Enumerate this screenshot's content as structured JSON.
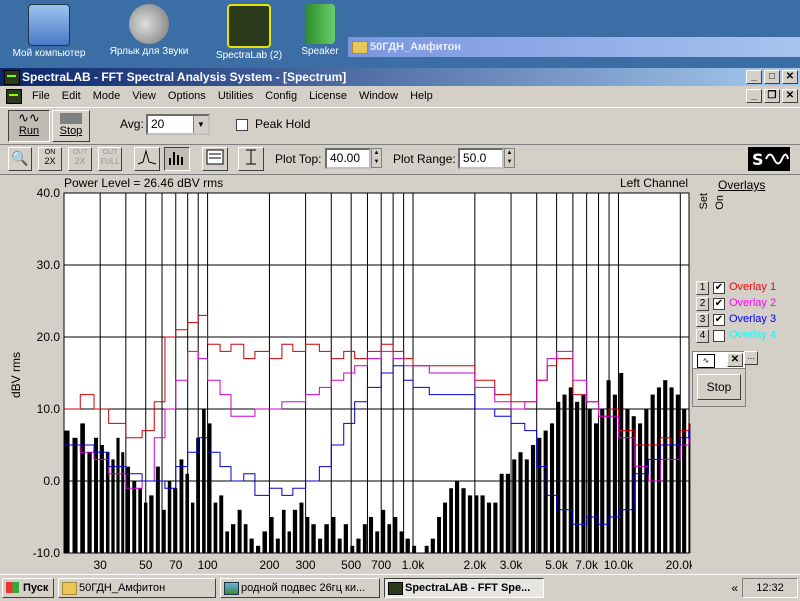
{
  "desktop": {
    "icons": [
      {
        "label": "Мой компьютер",
        "icon": "computer-icon"
      },
      {
        "label": "Ярлык для Звуки",
        "icon": "speaker-icon"
      },
      {
        "label": "SpectraLab (2)",
        "icon": "spectralab-icon"
      },
      {
        "label": "Speaker",
        "icon": "speaker-shortcut-icon"
      }
    ],
    "bg_window_title": "50ГДН_Амфитон"
  },
  "window": {
    "title": "SpectraLAB - FFT Spectral Analysis System - [Spectrum]"
  },
  "menu": [
    "File",
    "Edit",
    "Mode",
    "View",
    "Options",
    "Utilities",
    "Config",
    "License",
    "Window",
    "Help"
  ],
  "toolbar": {
    "run_label": "Run",
    "stop_label": "Stop",
    "avg_label": "Avg:",
    "avg_value": "20",
    "peak_hold_label": "Peak Hold",
    "zoom_btns": [
      {
        "top": "ON",
        "bottom": "2X"
      },
      {
        "top": "OUT",
        "bottom": "2X"
      },
      {
        "top": "OUT",
        "bottom": "FULL"
      }
    ],
    "plot_top_label": "Plot Top:",
    "plot_top_value": "40.00",
    "plot_range_label": "Plot Range:",
    "plot_range_value": "50.0"
  },
  "chart_header": {
    "power_level": "Power Level = 26.46 dBV rms",
    "channel": "Left Channel"
  },
  "chart_data": {
    "type": "bar",
    "ylabel": "dBV rms",
    "ylim": [
      -10,
      40
    ],
    "xscale": "log",
    "xlim": [
      20,
      22050
    ],
    "yticks": [
      "40.0",
      "30.0",
      "20.0",
      "10.0",
      "0.0",
      "-10.0"
    ],
    "xticks": [
      {
        "f": 30,
        "label": "30"
      },
      {
        "f": 50,
        "label": "50"
      },
      {
        "f": 70,
        "label": "70"
      },
      {
        "f": 100,
        "label": "100"
      },
      {
        "f": 200,
        "label": "200"
      },
      {
        "f": 300,
        "label": "300"
      },
      {
        "f": 500,
        "label": "500"
      },
      {
        "f": 700,
        "label": "700"
      },
      {
        "f": 1000,
        "label": "1.0k"
      },
      {
        "f": 2000,
        "label": "2.0k"
      },
      {
        "f": 3000,
        "label": "3.0k"
      },
      {
        "f": 5000,
        "label": "5.0k"
      },
      {
        "f": 7000,
        "label": "7.0k"
      },
      {
        "f": 10000,
        "label": "10.0k"
      },
      {
        "f": 20000,
        "label": "20.0k"
      }
    ],
    "gridlines": [
      30,
      40,
      50,
      60,
      70,
      80,
      90,
      100,
      200,
      300,
      400,
      500,
      600,
      700,
      800,
      900,
      1000,
      2000,
      3000,
      4000,
      5000,
      6000,
      7000,
      8000,
      9000,
      10000,
      20000
    ],
    "spectrum": [
      [
        20,
        7
      ],
      [
        22,
        6
      ],
      [
        24,
        8
      ],
      [
        26,
        4
      ],
      [
        28,
        6
      ],
      [
        30,
        5
      ],
      [
        32,
        4
      ],
      [
        34,
        3
      ],
      [
        36,
        6
      ],
      [
        38,
        4
      ],
      [
        40,
        2
      ],
      [
        43,
        0
      ],
      [
        46,
        -1
      ],
      [
        49,
        -3
      ],
      [
        52,
        -2
      ],
      [
        56,
        2
      ],
      [
        60,
        -4
      ],
      [
        64,
        0
      ],
      [
        68,
        -1
      ],
      [
        73,
        3
      ],
      [
        78,
        1
      ],
      [
        83,
        -3
      ],
      [
        88,
        6
      ],
      [
        94,
        10
      ],
      [
        100,
        8
      ],
      [
        107,
        -3
      ],
      [
        114,
        -2
      ],
      [
        122,
        -7
      ],
      [
        130,
        -6
      ],
      [
        140,
        -4
      ],
      [
        150,
        -6
      ],
      [
        160,
        -8
      ],
      [
        172,
        -9
      ],
      [
        185,
        -7
      ],
      [
        200,
        -5
      ],
      [
        215,
        -8
      ],
      [
        230,
        -4
      ],
      [
        245,
        -7
      ],
      [
        260,
        -4
      ],
      [
        280,
        -3
      ],
      [
        300,
        -5
      ],
      [
        320,
        -6
      ],
      [
        345,
        -8
      ],
      [
        370,
        -6
      ],
      [
        400,
        -5
      ],
      [
        430,
        -8
      ],
      [
        460,
        -6
      ],
      [
        495,
        -9
      ],
      [
        530,
        -8
      ],
      [
        570,
        -6
      ],
      [
        610,
        -5
      ],
      [
        655,
        -7
      ],
      [
        700,
        -4
      ],
      [
        750,
        -6
      ],
      [
        800,
        -5
      ],
      [
        860,
        -7
      ],
      [
        920,
        -8
      ],
      [
        990,
        -9
      ],
      [
        1060,
        -10
      ],
      [
        1140,
        -9
      ],
      [
        1220,
        -8
      ],
      [
        1310,
        -5
      ],
      [
        1400,
        -3
      ],
      [
        1500,
        -1
      ],
      [
        1600,
        0
      ],
      [
        1720,
        -1
      ],
      [
        1850,
        -2
      ],
      [
        1990,
        -2
      ],
      [
        2130,
        -2
      ],
      [
        2290,
        -3
      ],
      [
        2460,
        -3
      ],
      [
        2640,
        1
      ],
      [
        2830,
        1
      ],
      [
        3040,
        3
      ],
      [
        3260,
        4
      ],
      [
        3500,
        3
      ],
      [
        3750,
        5
      ],
      [
        4030,
        6
      ],
      [
        4320,
        7
      ],
      [
        4640,
        8
      ],
      [
        4980,
        11
      ],
      [
        5340,
        12
      ],
      [
        5730,
        13
      ],
      [
        6150,
        11
      ],
      [
        6600,
        12
      ],
      [
        7080,
        10
      ],
      [
        7600,
        8
      ],
      [
        8150,
        10
      ],
      [
        8750,
        14
      ],
      [
        9390,
        12
      ],
      [
        10080,
        15
      ],
      [
        10810,
        10
      ],
      [
        11600,
        9
      ],
      [
        12450,
        8
      ],
      [
        13360,
        10
      ],
      [
        14340,
        12
      ],
      [
        15390,
        13
      ],
      [
        16510,
        14
      ],
      [
        17720,
        13
      ],
      [
        19020,
        12
      ],
      [
        20410,
        10
      ],
      [
        21900,
        8
      ]
    ],
    "series": [
      {
        "name": "Overlay 1",
        "color": "#cc0000",
        "values": [
          [
            20,
            10
          ],
          [
            24,
            12
          ],
          [
            28,
            10
          ],
          [
            33,
            8
          ],
          [
            40,
            6
          ],
          [
            48,
            7
          ],
          [
            55,
            11
          ],
          [
            62,
            20
          ],
          [
            70,
            21
          ],
          [
            80,
            22
          ],
          [
            90,
            23
          ],
          [
            100,
            19
          ],
          [
            115,
            18
          ],
          [
            130,
            19
          ],
          [
            150,
            17
          ],
          [
            170,
            18
          ],
          [
            200,
            17
          ],
          [
            230,
            19
          ],
          [
            260,
            18
          ],
          [
            300,
            19
          ],
          [
            350,
            18
          ],
          [
            400,
            17
          ],
          [
            460,
            18
          ],
          [
            520,
            17
          ],
          [
            600,
            18
          ],
          [
            700,
            19
          ],
          [
            800,
            18
          ],
          [
            900,
            17
          ],
          [
            1000,
            16
          ],
          [
            1200,
            16
          ],
          [
            1500,
            16
          ],
          [
            2000,
            14
          ],
          [
            2500,
            12
          ],
          [
            3000,
            11
          ],
          [
            3500,
            11
          ],
          [
            4000,
            14
          ],
          [
            4500,
            16
          ],
          [
            5000,
            17
          ],
          [
            6000,
            12
          ],
          [
            7000,
            11
          ],
          [
            8000,
            9
          ],
          [
            9000,
            10
          ],
          [
            10000,
            7
          ],
          [
            12000,
            5
          ],
          [
            14000,
            5
          ],
          [
            16000,
            6
          ],
          [
            18000,
            5
          ],
          [
            20000,
            7
          ],
          [
            22000,
            8
          ]
        ]
      },
      {
        "name": "Overlay 2",
        "color": "#cc00cc",
        "values": [
          [
            20,
            5
          ],
          [
            24,
            4
          ],
          [
            28,
            3
          ],
          [
            33,
            1
          ],
          [
            40,
            -1
          ],
          [
            48,
            0
          ],
          [
            55,
            6
          ],
          [
            62,
            10
          ],
          [
            70,
            14
          ],
          [
            80,
            18
          ],
          [
            90,
            17
          ],
          [
            100,
            14
          ],
          [
            115,
            12
          ],
          [
            130,
            9
          ],
          [
            150,
            9
          ],
          [
            170,
            10
          ],
          [
            200,
            10
          ],
          [
            230,
            11
          ],
          [
            260,
            11
          ],
          [
            300,
            12
          ],
          [
            350,
            13
          ],
          [
            400,
            14
          ],
          [
            460,
            15
          ],
          [
            520,
            16
          ],
          [
            600,
            17
          ],
          [
            700,
            18
          ],
          [
            800,
            17
          ],
          [
            900,
            16
          ],
          [
            1000,
            16
          ],
          [
            1200,
            15
          ],
          [
            1500,
            15
          ],
          [
            2000,
            13
          ],
          [
            2500,
            11
          ],
          [
            3000,
            10
          ],
          [
            3500,
            11
          ],
          [
            4000,
            14
          ],
          [
            4500,
            17
          ],
          [
            5000,
            18
          ],
          [
            6000,
            14
          ],
          [
            7000,
            11
          ],
          [
            8000,
            9
          ],
          [
            9000,
            9
          ],
          [
            10000,
            6
          ],
          [
            12000,
            2
          ],
          [
            14000,
            0
          ],
          [
            16000,
            3
          ],
          [
            18000,
            3
          ],
          [
            20000,
            5
          ],
          [
            22000,
            7
          ]
        ]
      },
      {
        "name": "Overlay 3",
        "color": "#0000cc",
        "values": [
          [
            20,
            5
          ],
          [
            24,
            5
          ],
          [
            28,
            4
          ],
          [
            33,
            2
          ],
          [
            40,
            1
          ],
          [
            48,
            0
          ],
          [
            55,
            0
          ],
          [
            62,
            -1
          ],
          [
            70,
            2
          ],
          [
            80,
            4
          ],
          [
            90,
            6
          ],
          [
            100,
            4
          ],
          [
            115,
            2
          ],
          [
            130,
            0
          ],
          [
            150,
            1
          ],
          [
            170,
            -2
          ],
          [
            200,
            -1
          ],
          [
            230,
            -2
          ],
          [
            260,
            -1
          ],
          [
            300,
            0
          ],
          [
            350,
            2
          ],
          [
            400,
            5
          ],
          [
            460,
            8
          ],
          [
            520,
            11
          ],
          [
            600,
            13
          ],
          [
            700,
            15
          ],
          [
            800,
            16
          ],
          [
            900,
            14
          ],
          [
            1000,
            13
          ],
          [
            1200,
            12
          ],
          [
            1500,
            12
          ],
          [
            2000,
            10
          ],
          [
            2500,
            9
          ],
          [
            3000,
            8
          ],
          [
            3500,
            7
          ],
          [
            4000,
            2
          ],
          [
            4500,
            -2
          ],
          [
            5000,
            -4
          ],
          [
            6000,
            -6
          ],
          [
            7000,
            -5
          ],
          [
            8000,
            -6
          ],
          [
            9000,
            -5
          ],
          [
            10000,
            -4
          ],
          [
            12000,
            1
          ],
          [
            14000,
            3
          ],
          [
            16000,
            5
          ],
          [
            18000,
            5
          ],
          [
            20000,
            6
          ],
          [
            22000,
            7
          ]
        ]
      }
    ]
  },
  "overlays": {
    "title": "Overlays",
    "set_label": "Set",
    "on_label": "On",
    "items": [
      {
        "num": "1",
        "label": "Overlay 1",
        "color": "#ff0000",
        "checked": "✔"
      },
      {
        "num": "2",
        "label": "Overlay 2",
        "color": "#ff00ff",
        "checked": "✔"
      },
      {
        "num": "3",
        "label": "Overlay 3",
        "color": "#0000ff",
        "checked": "✔"
      },
      {
        "num": "4",
        "label": "Overlay 4",
        "color": "#00ffff",
        "checked": ""
      }
    ],
    "popup_ellipsis": "...",
    "popup_stop": "Stop"
  },
  "taskbar": {
    "start_label": "Пуск",
    "tasks": [
      {
        "label": "50ГДН_Амфитон",
        "icon": "folder-icon",
        "active": false
      },
      {
        "label": "родной подвес 26гц ки...",
        "icon": "image-icon",
        "active": false
      },
      {
        "label": "SpectraLAB - FFT Spe...",
        "icon": "spectralab-icon",
        "active": true
      }
    ],
    "tray_arrows": "«",
    "clock": "12:32"
  }
}
